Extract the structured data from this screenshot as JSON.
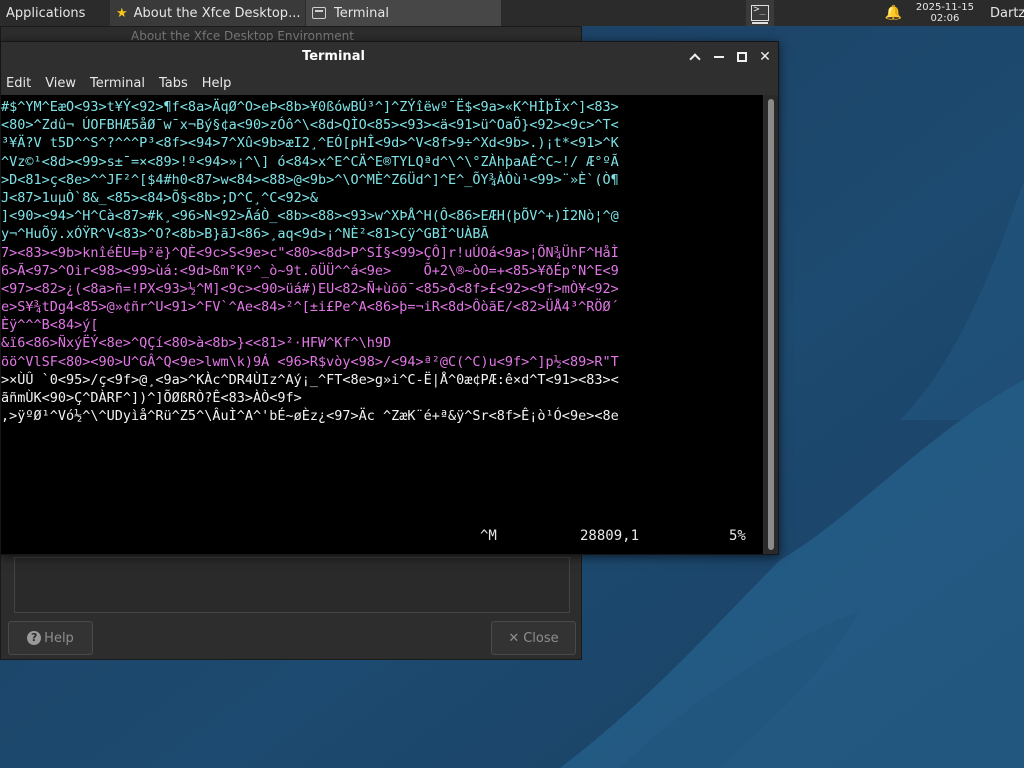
{
  "panel": {
    "applications_label": "Applications",
    "tasks": [
      {
        "label": "About the Xfce Desktop..."
      },
      {
        "label": "Terminal"
      }
    ],
    "clock_date": "2025-11-15",
    "clock_time": "02:06",
    "user": "Dartz"
  },
  "about_dialog": {
    "title": "About the Xfce Desktop Environment",
    "help_label": "Help",
    "close_label": "Close"
  },
  "terminal": {
    "title": "Terminal",
    "menu": [
      "Edit",
      "View",
      "Terminal",
      "Tabs",
      "Help"
    ],
    "lines": [
      {
        "text": "#$^YM^EæO<93>t¥Ý<92>¶f<8a>ÄqØ^O>eÞ<8b>¥0ßówBÚ³^]^ZÝîëwº¯Ë$<9a>«K^HÌþÏx^]<83>",
        "color": "cyan"
      },
      {
        "text": "<80>^Zdû¬ ÚOFBHÆ5åØ¯w¯x¬Bý§¢a<90>zÓô^\\<8d>QÌO<85><93><ä<91>ü^OaÕ}<92><9c>^T<",
        "color": "cyan"
      },
      {
        "text": "³¥Ä?V t5D^^S^?^^^P³<8f><94>7^Xû<9b>æI2¸^EÓ[pHÎ<9d>^V<8f>9÷^Xd<9b>.)¡t*<91>^K",
        "color": "cyan"
      },
      {
        "text": "^Vz©¹<8d><99>s±¯=×<89>!º<94>»¡^\\] ó<84>x^E^CÄ^E®TYLQªd^\\^\\°ZÀhþaAÊ^C~!/ Æ°ºÃ",
        "color": "cyan"
      },
      {
        "text": ">D<81>ç<8e>^^JF²^[$4#h0<87>w<84><88>@<9b>^\\O^MÈ^Z6Üd^]^E^_ÕY¾ÀÒù¹<99>¨»È`(Ò¶",
        "color": "cyan"
      },
      {
        "text": "J<87>1uµÒ`8&_<85><84>Õ§<8b>;D^C¸^C<92>&",
        "color": "cyan"
      },
      {
        "text": "]<90><94>^H^Cà<87>#k¸<96>N<92>ÃáÒ_<8b><88><93>w^XÞÅ^H(Ô<86>EÆH(þÕV^+)İ2Nò¦^@",
        "color": "cyan"
      },
      {
        "text": "y¬^HuÕÿ.xÓŸR^V<83>^O?<8b>B}ãJ<86>¸aq<9d>¡^NÈ²<81>Cÿ^GBÌ^UÀBÃ",
        "color": "cyan"
      },
      {
        "text": "7><83><9b>knîéÈU=þ²ë}^QÈ<9c>S<9e>c\"<80><8d>P^SÍ§<99>ÇÔ]r!uÚOá<9a>¦ÕN¾ÜhF^HåÌ",
        "color": "magenta"
      },
      {
        "text": "6>Ã<97>^Oir<98><99>ùá:<9d>ßm°Kº^_ò~9t.õÜÜ^^á<9e>    Õ+2\\®~òO=+<85>¥ðÉp°N^E<9",
        "color": "magenta"
      },
      {
        "text": "<97><82>¿(<8a>ñ=!PX<93>½^M]<9c><90>üá#)EU<82>Ñ+ùõõ¯<85>ð<8f>£<92><9f>mÒ¥<92>",
        "color": "magenta"
      },
      {
        "text": "e>S¥¾tDg4<85>@»¢ñr^U<91>^FV`^Ae<84>²^[±i£Pe^A<86>þ=¬iR<8d>ÔòãE/<82>ÜÅ4³^RÖØ´",
        "color": "magenta"
      },
      {
        "text": "Èÿ^^^B<84>ý[",
        "color": "magenta"
      },
      {
        "text": "&ï6<86>ÑxýËÝ<8e>^QÇí<80>à<8b>}<<81>²·HFW^Kf^\\h9D",
        "color": "magenta"
      },
      {
        "text": "õö^VlSF<80><90>U^GÂ^Q<9e>lwm\\k)9Á <96>R$vòy<98>/<94>ª²@C(^C)u<9f>^]p½<89>R\"T",
        "color": "magenta"
      },
      {
        "text": ">×ÙÛ `0<95>/ç<9f>@¸<9a>^KÀc^DR4ÙIz^Aý¡_^FT<8e>g»i^C-Ë|Å^0æ¢PÆ:ê×d^T<91><83><",
        "color": "white"
      },
      {
        "text": "ãñmÙK<90>Ç^DÀRF^])^]ÕØßRÒ?Ê<83>ÀÒ<9f>",
        "color": "white"
      },
      {
        "text": ",>ÿºØ¹^Vó½^\\^UDyìå^Rü^Z5^\\ÂuÌ^A^'bÉ~øÈz¿<97>Äc ^ZæK¨é+ª&ÿ^Sr<8f>Ê¡ò¹Ó<9e><8e",
        "color": "white"
      }
    ],
    "status": {
      "key": "^M",
      "position": "28809,1",
      "percent": "5%"
    }
  },
  "colors": {
    "term_cyan": "#7fe3e6",
    "term_magenta": "#e277e6",
    "term_white": "#f2f2f2",
    "panel_bg": "#2b2b2b",
    "window_bg": "#2e2e2e"
  }
}
